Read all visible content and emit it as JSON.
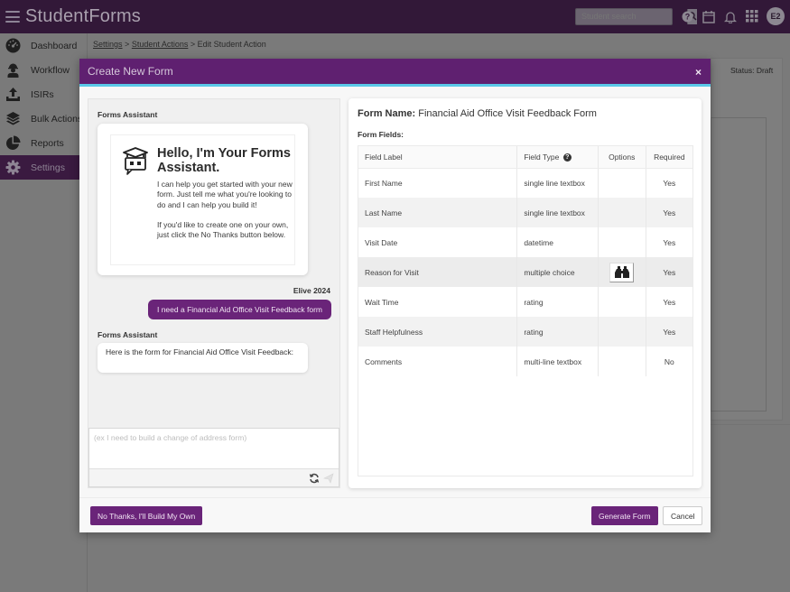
{
  "app": {
    "title": "StudentForms",
    "search_placeholder": "Student search",
    "user_initials": "E2"
  },
  "sidebar": {
    "items": [
      {
        "label": "Dashboard",
        "icon": "dashboard-gauge-icon"
      },
      {
        "label": "Workflow",
        "icon": "worker-icon"
      },
      {
        "label": "ISIRs",
        "icon": "upload-icon"
      },
      {
        "label": "Bulk Actions",
        "icon": "layers-icon"
      },
      {
        "label": "Reports",
        "icon": "pie-chart-icon"
      },
      {
        "label": "Settings",
        "icon": "gear-icon",
        "active": true
      }
    ]
  },
  "breadcrumb": {
    "items": [
      "Settings",
      "Student Actions",
      "Edit Student Action"
    ],
    "separator": ">"
  },
  "background": {
    "status": "Status: Draft"
  },
  "modal": {
    "title": "Create New Form",
    "close_label": "×",
    "chat": {
      "assistant_label": "Forms Assistant",
      "welcome_title": "Hello, I'm Your Forms Assistant.",
      "welcome_p1": " I can help you get started with your new form. Just tell me what you're looking to do and I can help you build it!",
      "welcome_p2": "If you'd like to create one on your own, just click the No Thanks button below.",
      "user_name": "Elive 2024",
      "user_message": "I need a Financial Aid Office Visit Feedback form",
      "assistant_label_2": "Forms Assistant",
      "assistant_reply": " Here is the form for Financial Aid Office Visit Feedback:",
      "input_placeholder": "(ex I need to build a change of address form)",
      "input_value": ""
    },
    "form": {
      "name_label": "Form Name:",
      "name_value": "Financial Aid Office Visit Feedback Form",
      "fields_label": "Form Fields:",
      "columns": [
        "Field Label",
        "Field Type",
        "Options",
        "Required"
      ],
      "rows": [
        {
          "label": "First Name",
          "type": "single line textbox",
          "has_options": false,
          "required": "Yes"
        },
        {
          "label": "Last Name",
          "type": "single line textbox",
          "has_options": false,
          "required": "Yes"
        },
        {
          "label": "Visit Date",
          "type": "datetime",
          "has_options": false,
          "required": "Yes"
        },
        {
          "label": "Reason for Visit",
          "type": "multiple choice",
          "has_options": true,
          "required": "Yes"
        },
        {
          "label": "Wait Time",
          "type": "rating",
          "has_options": false,
          "required": "Yes"
        },
        {
          "label": "Staff Helpfulness",
          "type": "rating",
          "has_options": false,
          "required": "Yes"
        },
        {
          "label": "Comments",
          "type": "multi-line textbox",
          "has_options": false,
          "required": "No"
        }
      ]
    },
    "footer": {
      "no_thanks_label": "No Thanks, I'll Build My Own",
      "generate_label": "Generate Form",
      "cancel_label": "Cancel"
    }
  },
  "colors": {
    "brand_dark": "#321838",
    "primary": "#6a2479",
    "accent_line": "#5ac8e8"
  }
}
